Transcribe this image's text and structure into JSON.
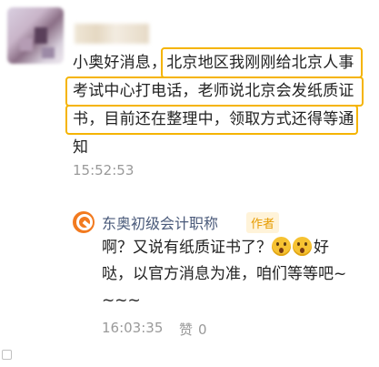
{
  "comment": {
    "text_lines": [
      "小奥好消息，北京地区我刚刚给北京人事",
      "考试中心打电话，老师说北京会发纸质证",
      "书，目前还在整理中，领取方式还得等通",
      "知"
    ],
    "time": "15:52:53"
  },
  "reply": {
    "author": "东奥初级会计职称",
    "badge": "作者",
    "line1_before": "啊？又说有纸质证书了？",
    "emoji_names": [
      "flushed-face-icon",
      "flushed-face-icon"
    ],
    "line1_after": "好",
    "line2": "哒，以官方消息为准，咱们等等吧~",
    "line3": "~~~",
    "time": "16:03:35",
    "like_label": "赞",
    "like_count": "0"
  },
  "colors": {
    "highlight": "#f5b400",
    "author_name": "#4a5a7a",
    "badge_text": "#e69b00",
    "timestamp": "#9a9a9a",
    "reply_avatar": "#f27a1f"
  }
}
